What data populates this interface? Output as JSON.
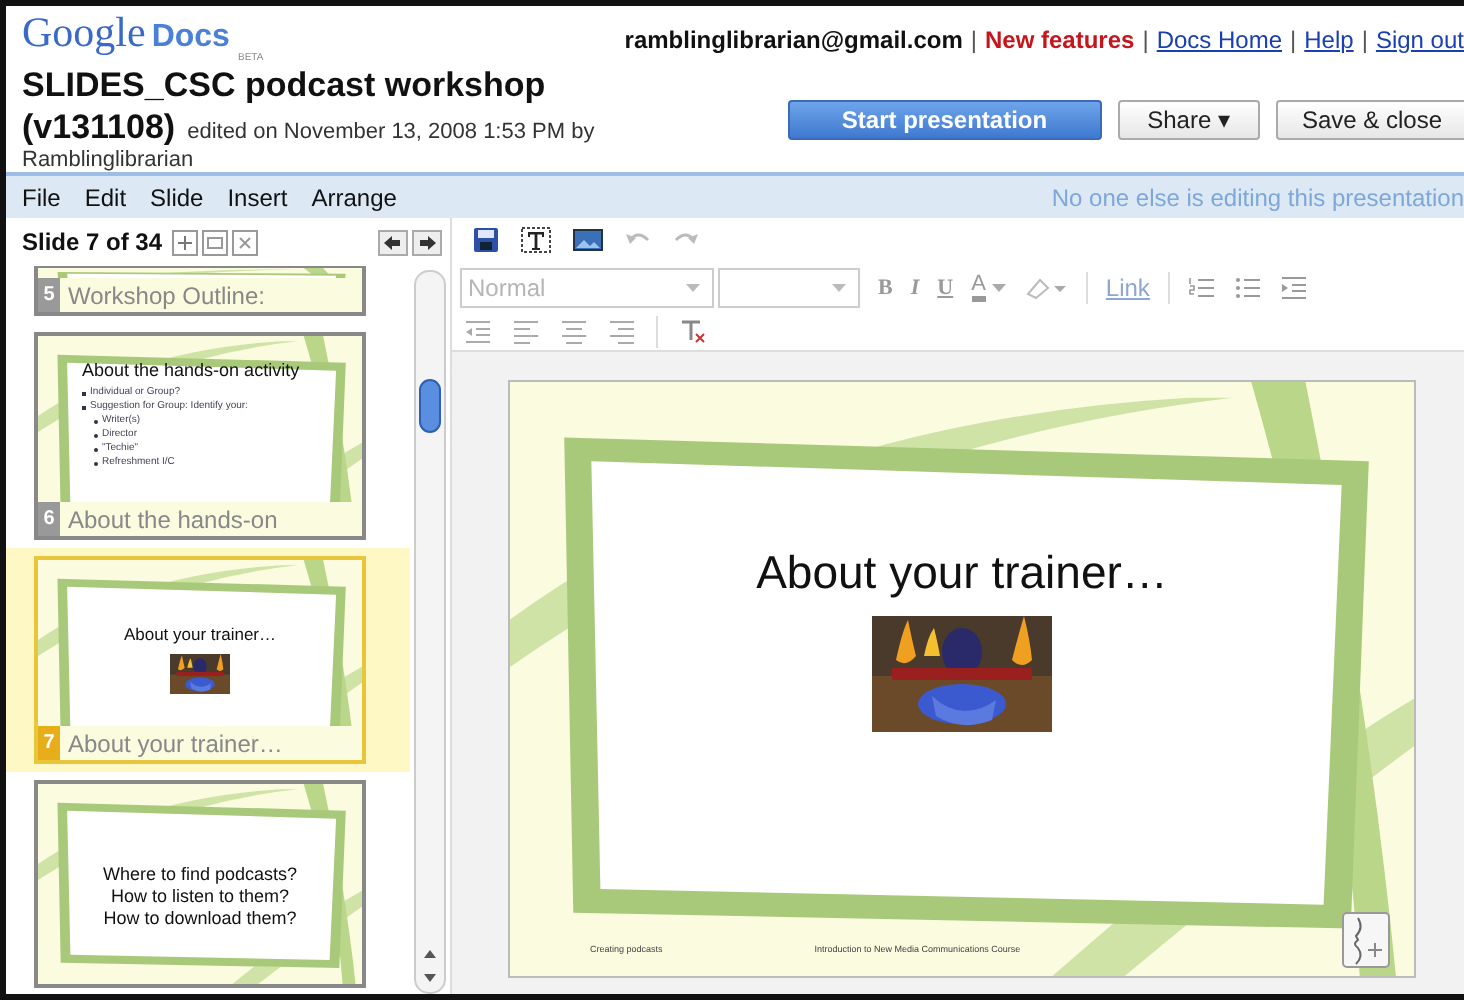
{
  "header": {
    "logo": {
      "brand": "Google",
      "product": "Docs",
      "badge": "BETA"
    },
    "account_links": [
      {
        "text": "ramblinglibrarian@gmail.com",
        "kind": "account"
      },
      {
        "text": "New features",
        "kind": "highlight"
      },
      {
        "text": "Docs Home",
        "kind": "link"
      },
      {
        "text": "Help",
        "kind": "link"
      },
      {
        "text": "Sign out",
        "kind": "link"
      }
    ],
    "separator": "|",
    "document": {
      "title": "SLIDES_CSC podcast workshop",
      "version": "(v131108)",
      "edited": "edited on November 13, 2008 1:53 PM by",
      "author": "Ramblinglibrarian"
    },
    "buttons": [
      {
        "label": "Start presentation",
        "kind": "primary"
      },
      {
        "label": "Share",
        "kind": "menu",
        "caret": "▾"
      },
      {
        "label": "Save & close",
        "kind": "plain"
      }
    ]
  },
  "menu_bar": {
    "items": [
      "File",
      "Edit",
      "Slide",
      "Insert",
      "Arrange"
    ],
    "status": "No one else is editing this presentation"
  },
  "slide_panel": {
    "counter": "Slide 7 of 34",
    "slides": [
      {
        "number": "5",
        "caption": "Workshop Outline:",
        "selected": false,
        "kind": "cut"
      },
      {
        "number": "6",
        "caption": "About the hands-on",
        "selected": false,
        "kind": "bullets",
        "heading": "About the hands-on activity",
        "bullets": [
          {
            "text": "Individual or Group?"
          },
          {
            "text": "Suggestion for Group: Identify your:",
            "children": [
              {
                "text": "Writer(s)"
              },
              {
                "text": "Director"
              },
              {
                "text": "\"Techie\""
              },
              {
                "text": "Refreshment I/C"
              }
            ]
          }
        ]
      },
      {
        "number": "7",
        "caption": "About your trainer…",
        "selected": true,
        "kind": "picture",
        "heading": "About your trainer…"
      },
      {
        "selected": false,
        "kind": "lines",
        "lines": [
          "Where to find podcasts?",
          "How to listen to them?",
          "How to download them?"
        ]
      }
    ]
  },
  "toolbar": {
    "style_select": {
      "value": "Normal",
      "disabled": true
    },
    "link": "Link",
    "format_letters": [
      "B",
      "I",
      "U",
      "A"
    ]
  },
  "slide": {
    "title": "About your trainer…",
    "footer_left": "Creating podcasts",
    "footer_center": "Introduction to New Media Communications Course"
  }
}
